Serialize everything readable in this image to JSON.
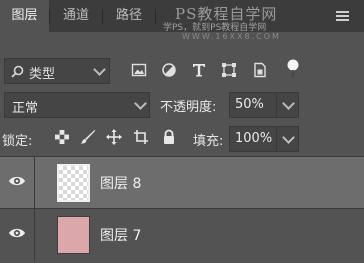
{
  "tabs": [
    {
      "label": "图层",
      "active": true
    },
    {
      "label": "通道",
      "active": false
    },
    {
      "label": "路径",
      "active": false
    }
  ],
  "watermark": {
    "line1": "PS教程自学网",
    "line2": "学PS，就到PS教程自学网",
    "line3": "WWW.16XX8.COM"
  },
  "filter": {
    "kind_label": "类型",
    "icons": [
      "image-filter-icon",
      "adjustment-filter-icon",
      "type-filter-icon",
      "shape-filter-icon",
      "smart-object-filter-icon",
      "filter-toggle-icon"
    ]
  },
  "blend": {
    "mode": "正常",
    "opacity_label": "不透明度:",
    "opacity_value": "50%"
  },
  "lock": {
    "label": "锁定:",
    "icons": [
      "lock-transparent-pixels-icon",
      "lock-image-pixels-icon",
      "lock-position-icon",
      "lock-artboard-icon",
      "lock-all-icon"
    ],
    "fill_label": "填充:",
    "fill_value": "100%"
  },
  "layers": [
    {
      "name": "图层 8",
      "visible": true,
      "selected": true,
      "thumbnail": "transparent",
      "thumb_color": ""
    },
    {
      "name": "图层 7",
      "visible": true,
      "selected": false,
      "thumbnail": "solid",
      "thumb_color": "#dba7aa"
    }
  ],
  "colors": {
    "panel_bg": "#535353",
    "tabbar_bg": "#3c3c3c",
    "selected_layer_bg": "#6d6d6d",
    "layer7_thumb": "#dba7aa"
  }
}
